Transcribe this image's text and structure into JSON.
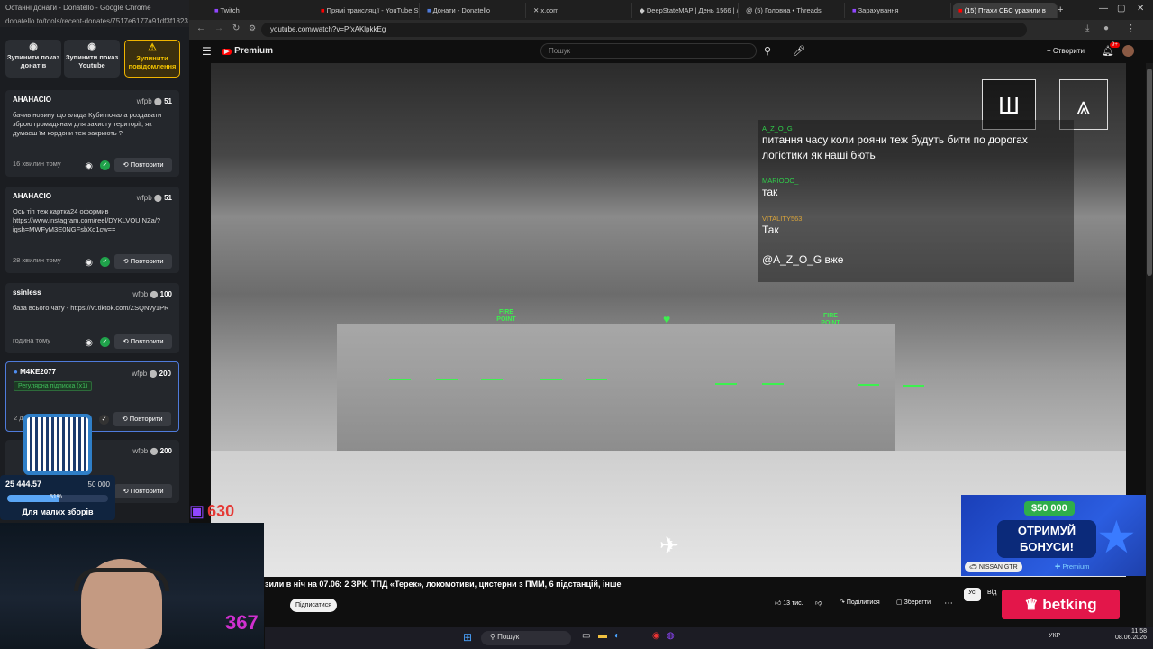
{
  "left_window": {
    "title": "Останні донати - Donatello - Google Chrome",
    "url": "donatello.to/tools/recent-donates/7517e6177a91df3f1823...",
    "buttons": [
      {
        "label": "Зупинити показ донатів",
        "icon": "stop-circle-icon"
      },
      {
        "label": "Зупинити показ Youtube",
        "icon": "stop-circle-icon"
      },
      {
        "label": "Зупинити повідомлення",
        "icon": "warning-icon",
        "color": "#f0b400"
      }
    ],
    "donations": [
      {
        "name": "АНАНАСІО",
        "source": "wfpb",
        "amount": "51",
        "message": "бачив новину що влада Куби почала роздавати зброю громадянам для захисту території, як думаєш їм кордони теж закриють ?",
        "time": "16 хвилин тому",
        "repeat": "Повторити"
      },
      {
        "name": "АНАНАСІО",
        "source": "wfpb",
        "amount": "51",
        "message": "Ось тіп теж картка24 оформив https://www.instagram.com/reel/DYKLVOUINZa/?igsh=MWFyM3E0NGFsbXo1cw==",
        "time": "28 хвилин тому",
        "repeat": "Повторити"
      },
      {
        "name": "ssinless",
        "source": "wfpb",
        "amount": "100",
        "message": "база всього чату - https://vt.tiktok.com/ZSQNvy1PR",
        "time": "година тому",
        "repeat": "Повторити"
      },
      {
        "name": "M4KE2077",
        "source": "wfpb",
        "amount": "200",
        "tag": "Регулярна підписка (x1)",
        "time": "2 д",
        "repeat": "Повторити"
      },
      {
        "name": "",
        "source": "wfpb",
        "amount": "200",
        "time": "",
        "repeat": "Повторити"
      }
    ]
  },
  "tabs": [
    {
      "label": "Twitch"
    },
    {
      "label": "Прямі трансляції - YouTube St"
    },
    {
      "label": "Донати - Donatello"
    },
    {
      "label": "x.com"
    },
    {
      "label": "DeepStateMAP | День 1566 | /"
    },
    {
      "label": "(5) Головна • Threads"
    },
    {
      "label": "Зарахування"
    },
    {
      "label": "(15) Птахи СБС уразили в",
      "active": true
    }
  ],
  "address_url": "youtube.com/watch?v=PfxAKlpkkEg",
  "youtube": {
    "logo": "Premium",
    "search_placeholder": "Пошук",
    "create_label": "Створити",
    "notif_count": "9+"
  },
  "chat": [
    {
      "user": "A_Z_O_G",
      "text": "питання часу коли рояни теж будуть бити по дорогах логістики як наші бють",
      "color": "#2fd04a"
    },
    {
      "user": "MARIOOO_",
      "text": "так",
      "color": "#2fd04a"
    },
    {
      "user": "VITALITY563",
      "text": "Так",
      "color": "#d9a43a"
    },
    {
      "user": "",
      "text": "@A_Z_O_G вже",
      "color": "#c43030"
    }
  ],
  "hud": {
    "fire_point_left": "FIRE POINT",
    "fire_point_right": "FIRE POINT"
  },
  "video_title": "зили в ніч на 07.06: 2 ЗРК, ТПД «Терек», локомотиви, цистерни з ПММ, 6 підстанцій, інше",
  "subscribe_label": "Підписатися",
  "actions": {
    "likes": "13 тис.",
    "share": "Поділитися",
    "save": "Зберегти"
  },
  "chips": {
    "all": "Усі",
    "from": "Від"
  },
  "overlay": {
    "goal_collected": "25 444.57",
    "goal_target": "50 000",
    "goal_percent_label": "51%",
    "goal_percent": 51,
    "goal_name": "Для малих зборів",
    "twitch_viewers": "630",
    "counter": "367"
  },
  "ad": {
    "price": "$50 000",
    "line1": "ОТРИМУЙ",
    "line2": "БОНУСИ!",
    "car": "NISSAN GTR",
    "premium": "Premium",
    "brand": "betking"
  },
  "taskbar": {
    "search": "Пошук",
    "lang": "УКР",
    "time": "11:58",
    "date": "08.06.2026"
  }
}
